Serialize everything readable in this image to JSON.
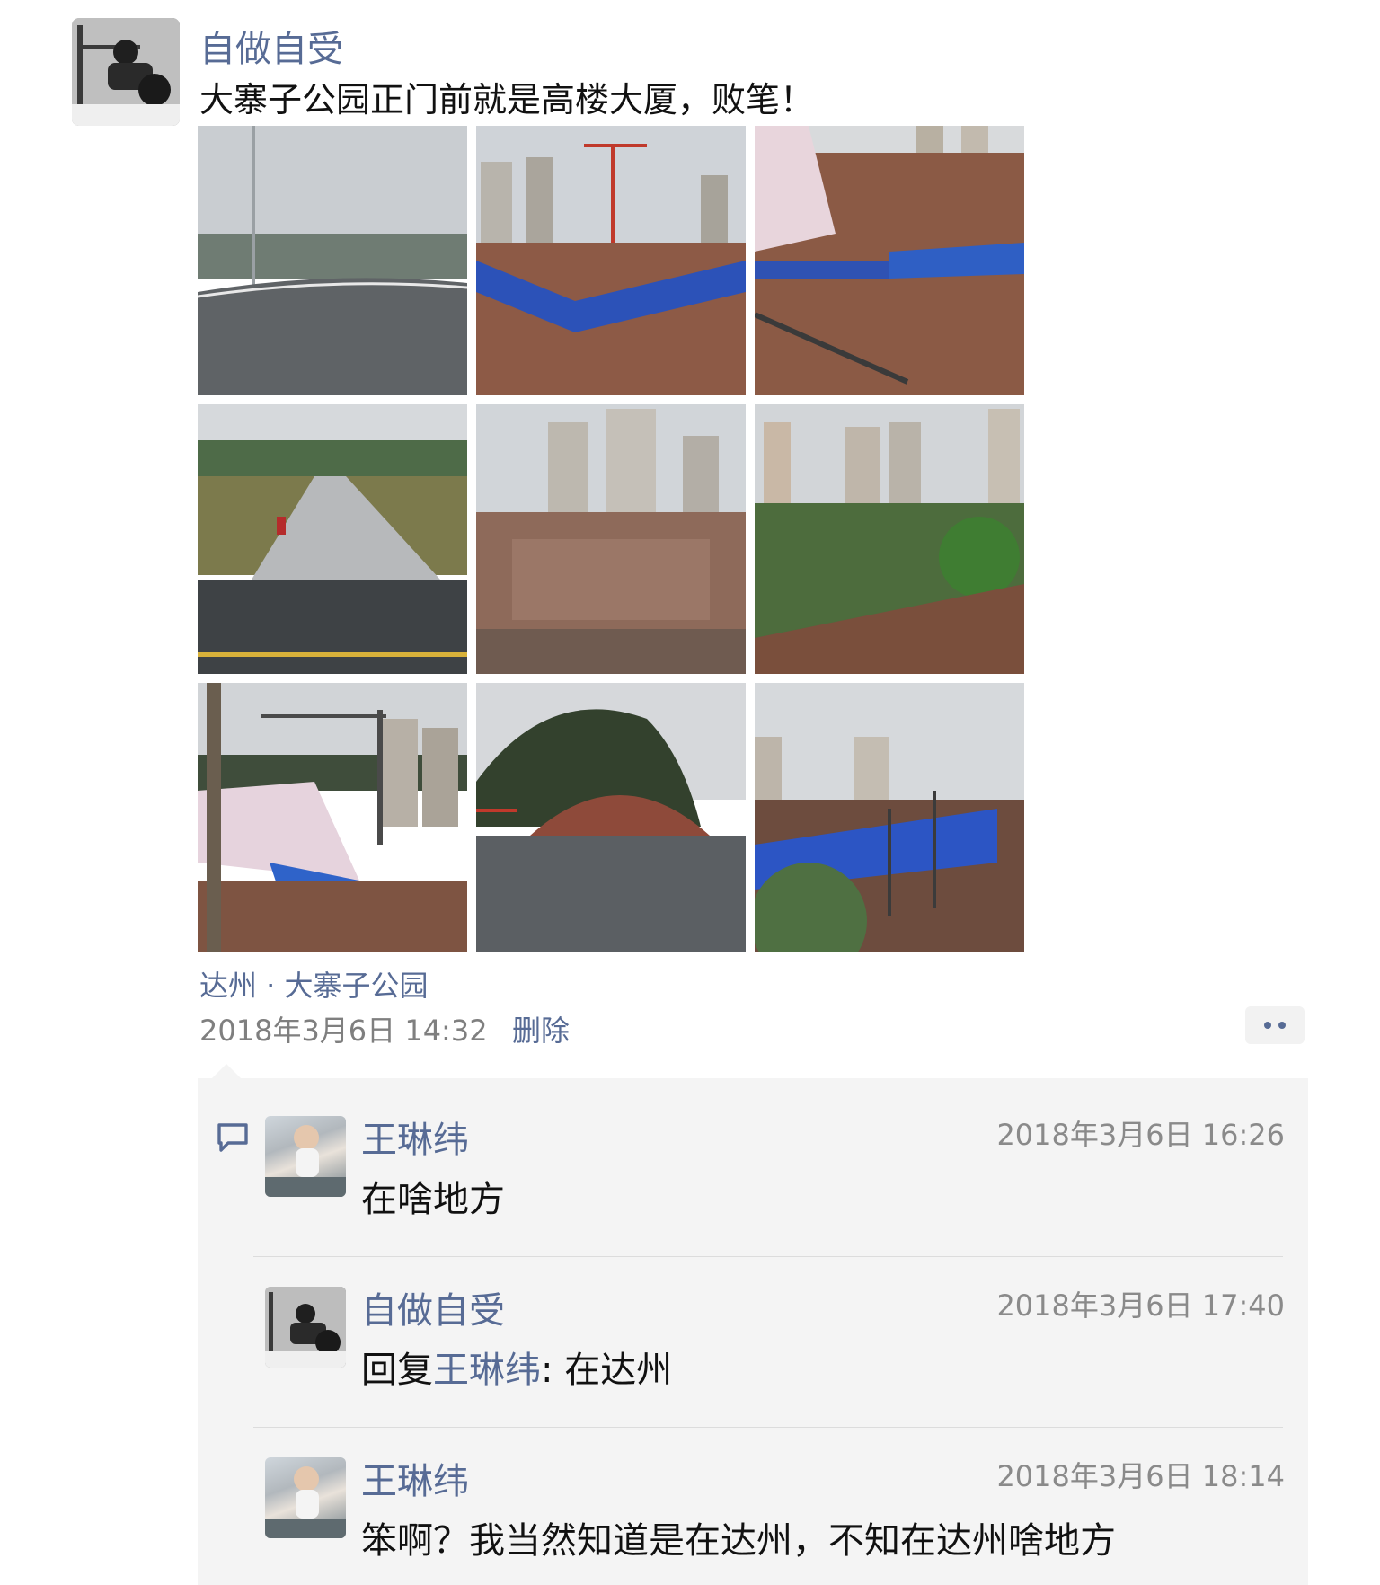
{
  "post": {
    "author": "自做自受",
    "text": "大寨子公园正门前就是高楼大厦，败笔！",
    "location": "达州 · 大寨子公园",
    "time": "2018年3月6日 14:32",
    "delete_label": "删除",
    "more_label": "••"
  },
  "photos": [
    {
      "alt": "park entrance road"
    },
    {
      "alt": "construction site with crane"
    },
    {
      "alt": "construction site with blue fence"
    },
    {
      "alt": "park walkway"
    },
    {
      "alt": "construction site and high-rises"
    },
    {
      "alt": "high-rises and trees"
    },
    {
      "alt": "tower crane and slope"
    },
    {
      "alt": "hill and road"
    },
    {
      "alt": "blue fence and trees"
    }
  ],
  "comments": [
    {
      "name": "王琳纬",
      "time": "2018年3月6日 16:26",
      "text": "在啥地方"
    },
    {
      "name": "自做自受",
      "time": "2018年3月6日 17:40",
      "reply_prefix": "回复",
      "reply_to": "王琳纬",
      "text": ": 在达州"
    },
    {
      "name": "王琳纬",
      "time": "2018年3月6日 18:14",
      "text": "笨啊？我当然知道是在达州，不知在达州啥地方"
    }
  ],
  "colors": {
    "link": "#576b95",
    "comment_bg": "#f4f4f4"
  },
  "icons": {
    "comment": "comment-bubble-icon",
    "more": "more-dots-icon"
  }
}
